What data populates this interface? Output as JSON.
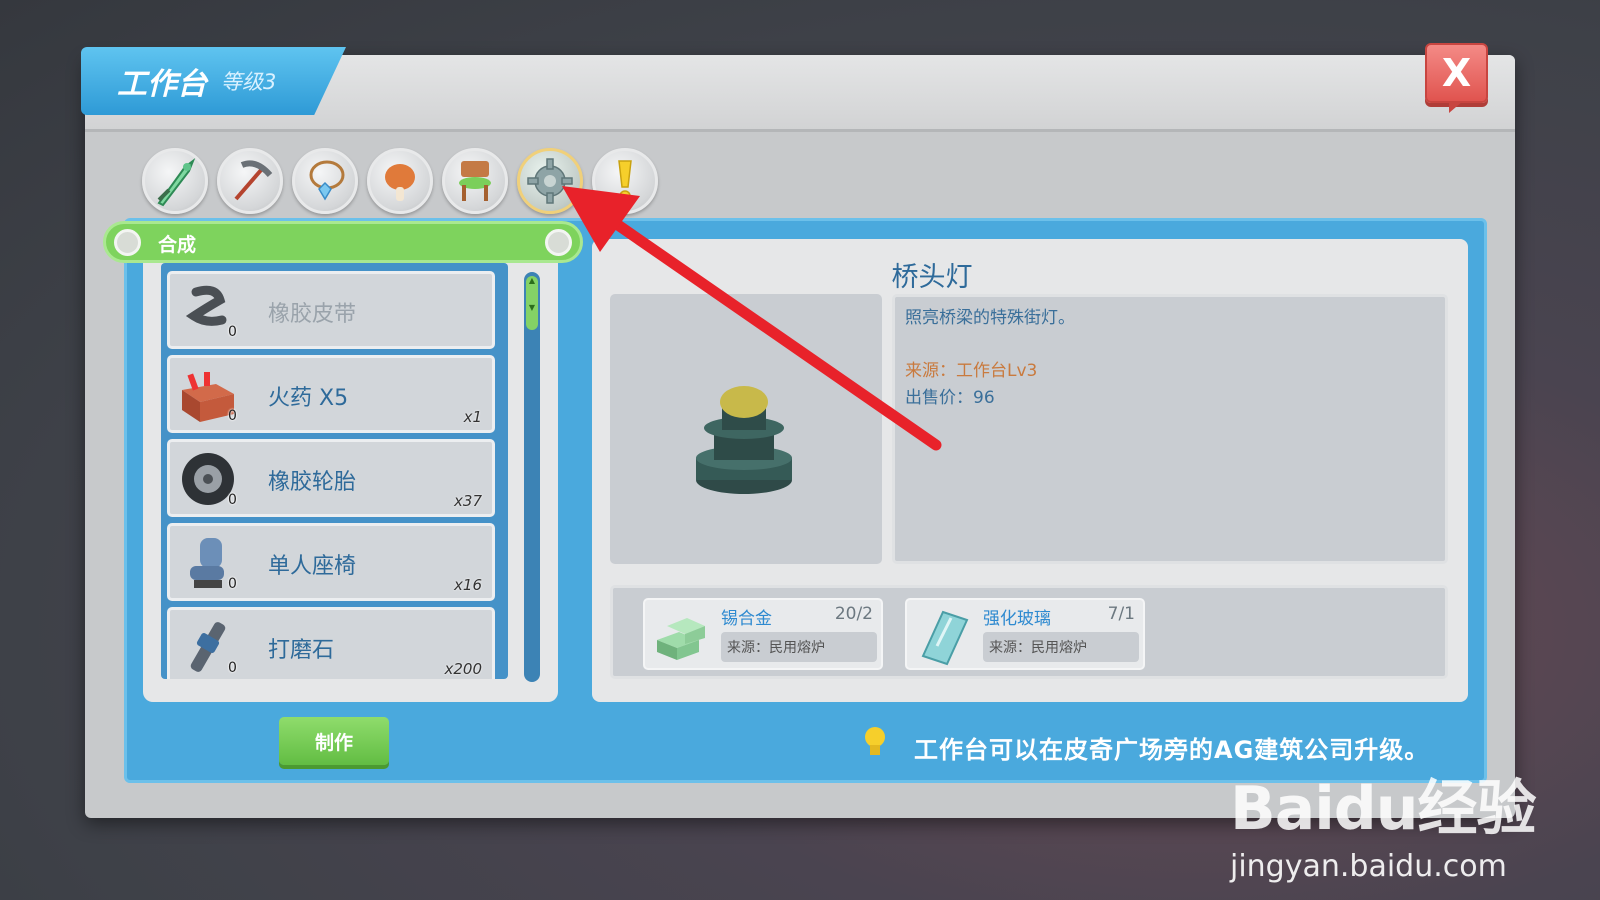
{
  "window": {
    "title": "工作台",
    "level": "等级3",
    "close_label": "X"
  },
  "categories": [
    {
      "icon": "sword-icon"
    },
    {
      "icon": "pickaxe-icon"
    },
    {
      "icon": "necklace-icon"
    },
    {
      "icon": "meat-icon"
    },
    {
      "icon": "chair-icon"
    },
    {
      "icon": "gear-icon",
      "active": true
    },
    {
      "icon": "exclamation-icon"
    }
  ],
  "section": {
    "label": "合成"
  },
  "recipes": [
    {
      "name": "橡胶皮带",
      "count": "0",
      "qty": "",
      "icon": "rubber-belt-icon",
      "disabled": true
    },
    {
      "name": "火药 X5",
      "count": "0",
      "qty": "x1",
      "icon": "gunpowder-crate-icon"
    },
    {
      "name": "橡胶轮胎",
      "count": "0",
      "qty": "x37",
      "icon": "tire-icon"
    },
    {
      "name": "单人座椅",
      "count": "0",
      "qty": "x16",
      "icon": "seat-icon"
    },
    {
      "name": "打磨石",
      "count": "0",
      "qty": "x200",
      "icon": "grinder-icon"
    }
  ],
  "actions": {
    "make_label": "制作"
  },
  "detail": {
    "title": "桥头灯",
    "description": "照亮桥梁的特殊街灯。",
    "source": "来源：工作台Lv3",
    "price": "出售价：96",
    "preview_icon": "bridge-lamp-icon"
  },
  "materials": [
    {
      "name": "锡合金",
      "qty": "20/2",
      "source": "来源：民用熔炉",
      "icon": "tin-alloy-icon"
    },
    {
      "name": "强化玻璃",
      "qty": "7/1",
      "source": "来源：民用熔炉",
      "icon": "glass-pane-icon"
    }
  ],
  "tip": {
    "text": "工作台可以在皮奇广场旁的AG建筑公司升级。",
    "icon": "lightbulb-icon"
  },
  "watermark": {
    "logo": "Baidu经验",
    "url": "jingyan.baidu.com"
  },
  "colors": {
    "accent_blue": "#4aa9dd",
    "green": "#7ed35d",
    "close_red": "#e0544f",
    "arrow_red": "#e8222a"
  }
}
